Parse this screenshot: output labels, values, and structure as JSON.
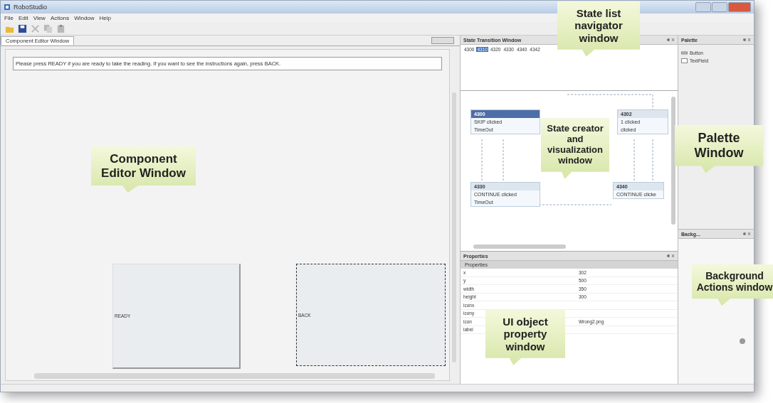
{
  "window": {
    "title": "RoboStudio"
  },
  "menu": [
    "File",
    "Edit",
    "View",
    "Actions",
    "Window",
    "Help"
  ],
  "toolbar": [
    {
      "kind": "open",
      "disabled": false
    },
    {
      "kind": "save",
      "disabled": false
    },
    {
      "kind": "cut",
      "disabled": true
    },
    {
      "kind": "copy",
      "disabled": true
    },
    {
      "kind": "paste",
      "disabled": true
    }
  ],
  "editor": {
    "tab": "Component Editor Window",
    "message": "Please press READY if you are ready to take the reading. If you want to see the instructions again, press BACK.",
    "buttons": [
      {
        "label": "READY",
        "selected": false
      },
      {
        "label": "BACK",
        "selected": true
      }
    ]
  },
  "state_window": {
    "title": "State Transition Window",
    "state_list": [
      {
        "label": "4300",
        "selected": false
      },
      {
        "label": "4310",
        "selected": true
      },
      {
        "label": "4320",
        "selected": false
      },
      {
        "label": "4330",
        "selected": false
      },
      {
        "label": "4340",
        "selected": false
      },
      {
        "label": "4342",
        "selected": false
      }
    ],
    "states": [
      {
        "id": "4300",
        "selected": true,
        "events": [
          "SKIP clicked",
          "TimeOut"
        ]
      },
      {
        "id": "4302",
        "selected": false,
        "events": [
          "1 clicked",
          "clicked"
        ]
      },
      {
        "id": "4330",
        "selected": false,
        "events": [
          "CONTINUE clicked",
          "TimeOut"
        ]
      },
      {
        "id": "4340",
        "selected": false,
        "events": [
          "CONTINUE clicke"
        ]
      }
    ]
  },
  "properties": {
    "title": "Properties",
    "header": "Properties",
    "rows": [
      {
        "name": "x",
        "value": "302"
      },
      {
        "name": "y",
        "value": "500"
      },
      {
        "name": "width",
        "value": "350"
      },
      {
        "name": "height",
        "value": "300"
      },
      {
        "name": "iconx",
        "value": ""
      },
      {
        "name": "icony",
        "value": ""
      },
      {
        "name": "icon",
        "value": "Wrong2.png"
      },
      {
        "name": "label",
        "value": ""
      }
    ]
  },
  "palette": {
    "title": "Palette",
    "items": [
      {
        "kind": "button",
        "label": "Button"
      },
      {
        "kind": "textfield",
        "label": "TextField"
      }
    ]
  },
  "background": {
    "title": "Backg..."
  },
  "callouts": [
    "State list navigator window",
    "Component Editor Window",
    "State creator and visualization window",
    "Palette Window",
    "UI object property window",
    "Background Actions window"
  ]
}
